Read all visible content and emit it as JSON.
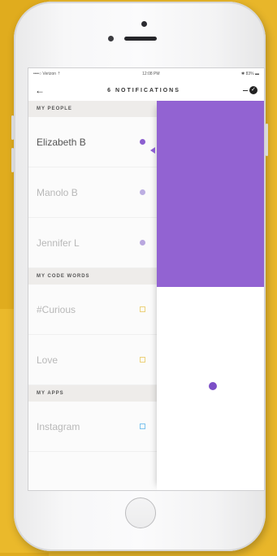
{
  "status_bar": {
    "carrier": "••••○ Verizon ⇡",
    "time": "12:08 PM",
    "battery": "✱ 83% ▬"
  },
  "header": {
    "back_icon": "←",
    "title": "6 NOTIFICATIONS",
    "done_icon": "✓"
  },
  "sections": [
    {
      "title": "MY PEOPLE",
      "rows": [
        {
          "label": "Elizabeth B",
          "marker": "circle",
          "color": "#8c5fd0",
          "active": true
        },
        {
          "label": "Manolo B",
          "marker": "circle",
          "color": "#bcaee2",
          "active": false
        },
        {
          "label": "Jennifer L",
          "marker": "circle",
          "color": "#b9a7df",
          "active": false
        }
      ]
    },
    {
      "title": "MY CODE WORDS",
      "rows": [
        {
          "label": "#Curious",
          "marker": "square",
          "color": "#ecd17a",
          "active": false
        },
        {
          "label": "Love",
          "marker": "square",
          "color": "#ecd17a",
          "active": false
        }
      ]
    },
    {
      "title": "MY APPS",
      "rows": [
        {
          "label": "Instagram",
          "marker": "square",
          "color": "#7cc3ee",
          "active": false
        }
      ]
    }
  ],
  "preview": {
    "accent": "#9263d2",
    "dot_color": "#7c4fc7"
  }
}
